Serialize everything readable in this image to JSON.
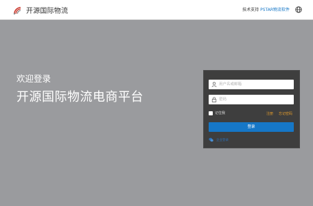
{
  "header": {
    "brand_title": "开源国际物流",
    "support_prefix": "技术支持",
    "support_link": "PSTAR物流软件",
    "logo_icon": "signal-arc-logo",
    "language_icon": "globe-icon"
  },
  "hero": {
    "welcome": "欢迎登录",
    "platform_name": "开源国际物流电商平台"
  },
  "login": {
    "username_placeholder": "用户名或邮箱",
    "password_placeholder": "密码",
    "remember_label": "记住我",
    "register_link": "注册",
    "forgot_link": "忘记密码",
    "submit_label": "登录",
    "corporate_login_label": "企业登录"
  },
  "colors": {
    "page_background": "#9a9b9e",
    "panel_background": "#3e3e3e",
    "primary": "#1677c7",
    "link_orange": "#e09a2c",
    "logo_red": "#c9362b"
  }
}
